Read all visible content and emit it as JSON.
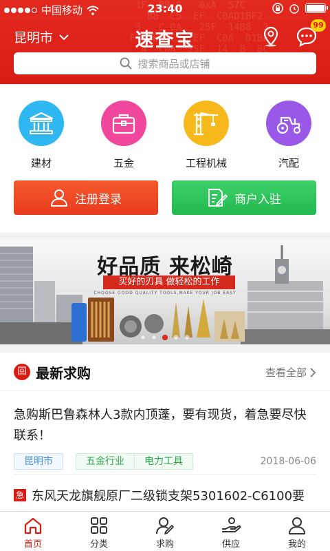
{
  "status_bar": {
    "carrier": "中国移动",
    "time": "23:40"
  },
  "header": {
    "city": "昆明市",
    "logo": "速查宝",
    "message_badge": "99",
    "accent_color": "#d81c14"
  },
  "search": {
    "placeholder": "搜索商品或店铺"
  },
  "categories": [
    {
      "label": "建材",
      "icon": "building-icon",
      "color": "#2eb7f0"
    },
    {
      "label": "五金",
      "icon": "toolbox-icon",
      "color": "#f0469c"
    },
    {
      "label": "工程机械",
      "icon": "crane-icon",
      "color": "#f6b81a"
    },
    {
      "label": "汽配",
      "icon": "tractor-icon",
      "color": "#9a58e8"
    }
  ],
  "actions": {
    "register_login": "注册登录",
    "merchant_join": "商户入驻"
  },
  "banner": {
    "headline": "好品质  来松崎",
    "subline": "买好的刃具  做轻松的工作",
    "small_text": "CHOOSE GOOD QUALITY TOOLS,MAKE YOUR JOB EASY",
    "slides": 5,
    "active_slide": 2
  },
  "latest_requests": {
    "icon_char": "回",
    "title": "最新求购",
    "view_all": "查看全部",
    "items": [
      {
        "text": "急购斯巴鲁森林人3款内顶蓬，要有现货，着急要尽快联系！",
        "location_tag": "昆明市",
        "industry_tags": [
          "五金行业",
          "电力工具"
        ],
        "date": "2018-06-06"
      },
      {
        "urgent": "急",
        "text": "东风天龙旗舰原厂二级锁支架5301602-C6100要"
      }
    ]
  },
  "tabbar": [
    {
      "label": "首页",
      "icon": "home-icon",
      "active": true
    },
    {
      "label": "分类",
      "icon": "grid-icon",
      "active": false
    },
    {
      "label": "求购",
      "icon": "buyer-icon",
      "active": false
    },
    {
      "label": "供应",
      "icon": "supply-hand-icon",
      "active": false
    },
    {
      "label": "我的",
      "icon": "user-icon",
      "active": false
    }
  ]
}
